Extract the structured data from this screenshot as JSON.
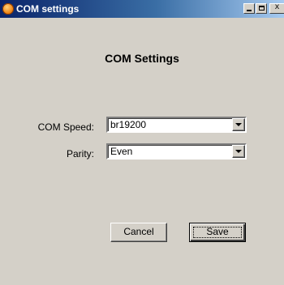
{
  "window": {
    "title": "COM settings",
    "app_icon": "orange-circle-icon",
    "controls": {
      "minimize": "_",
      "maximize": "□",
      "close": "x"
    }
  },
  "form": {
    "heading": "COM Settings",
    "fields": [
      {
        "label": "COM Speed:",
        "value": "br19200"
      },
      {
        "label": "Parity:",
        "value": "Even"
      }
    ]
  },
  "buttons": {
    "cancel": "Cancel",
    "save": "Save"
  },
  "colors": {
    "face": "#d4d0c8",
    "title_start": "#0a246a",
    "title_end": "#a6caf0"
  }
}
